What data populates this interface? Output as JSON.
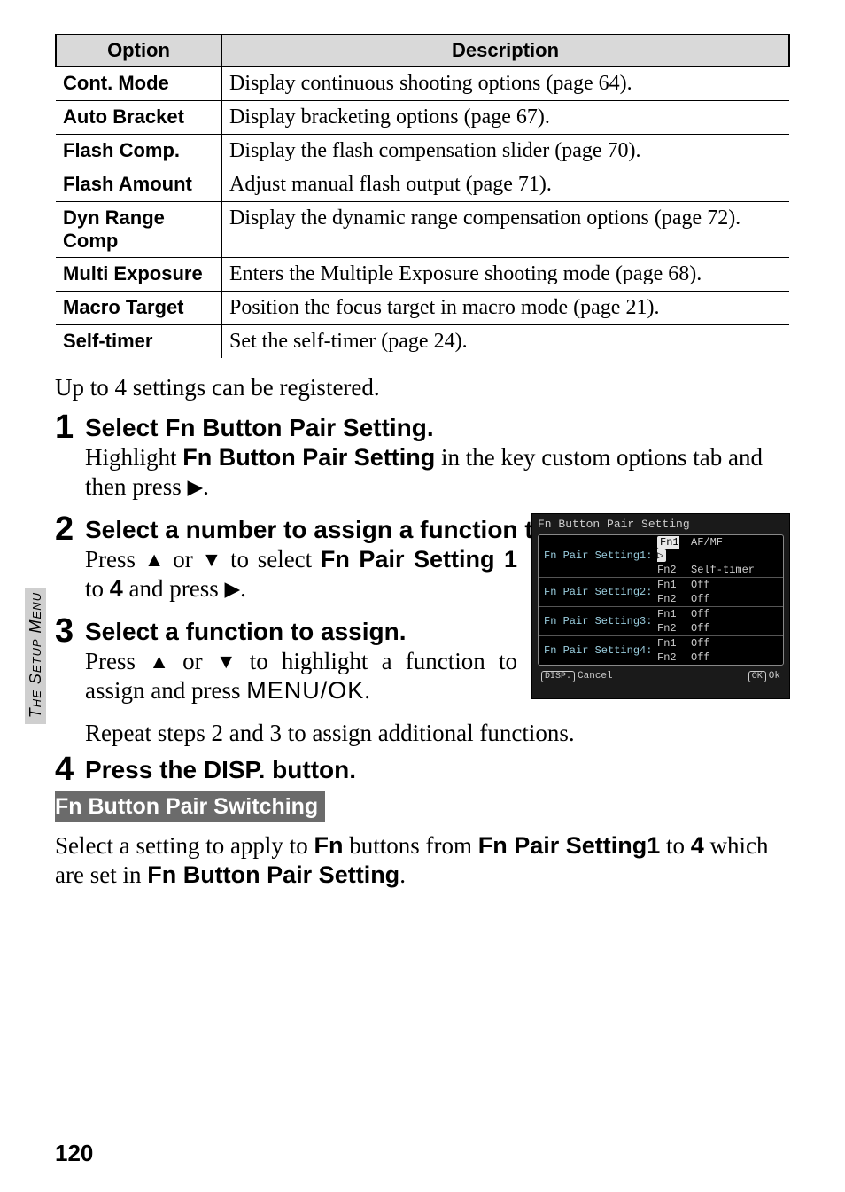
{
  "sidebar_label": "The Setup Menu",
  "table": {
    "headers": {
      "option": "Option",
      "description": "Description"
    },
    "rows": [
      {
        "name": "Cont. Mode",
        "desc": "Display continuous shooting options (page 64)."
      },
      {
        "name": "Auto Bracket",
        "desc": "Display bracketing options (page 67)."
      },
      {
        "name": "Flash Comp.",
        "desc": "Display the flash compensation slider (page 70)."
      },
      {
        "name": "Flash Amount",
        "desc": "Adjust manual flash output (page 71)."
      },
      {
        "name": "Dyn Range Comp",
        "desc": "Display the dynamic range compensation options (page 72)."
      },
      {
        "name": "Multi Exposure",
        "desc": "Enters the Multiple Exposure shooting mode (page 68)."
      },
      {
        "name": "Macro Target",
        "desc": "Position the focus target in macro mode (page 21)."
      },
      {
        "name": "Self-timer",
        "desc": "Set the self-timer (page 24)."
      }
    ]
  },
  "intro": "Up to 4 settings can be registered.",
  "steps": {
    "s1": {
      "num": "1",
      "head_pre": "Select ",
      "head_bold": "Fn Button Pair Setting",
      "head_post": ".",
      "body_pre": "Highlight ",
      "body_bold": "Fn Button Pair Setting",
      "body_mid": " in the key custom options tab and then press ",
      "body_icon": "▶",
      "body_post": "."
    },
    "s2": {
      "num": "2",
      "head": "Select a number to assign a function to.",
      "body_pre": "Press ",
      "body_up": "▲",
      "body_or": " or ",
      "body_dn": "▼",
      "body_mid": " to select ",
      "body_bold1": "Fn Pair Setting 1",
      "body_to": " to ",
      "body_bold2": "4",
      "body_and": " and press ",
      "body_icon": "▶",
      "body_post": "."
    },
    "s3": {
      "num": "3",
      "head": "Select a function to assign.",
      "body_pre": "Press ",
      "body_up": "▲",
      "body_or": " or ",
      "body_dn": "▼",
      "body_mid": " to highlight a function to assign and press ",
      "body_menuok": "MENU/OK",
      "body_post": "."
    },
    "s4": {
      "num": "4",
      "head_pre": "Press the ",
      "head_disp": "DISP.",
      "head_post": " button."
    }
  },
  "repeat": "Repeat steps 2 and 3 to assign additional functions.",
  "screenshot": {
    "title": "Fn Button Pair Setting",
    "rows": [
      {
        "label": "Fn Pair Setting1:",
        "fn1": "Fn1 ▷",
        "v1": "AF/MF",
        "fn2": "Fn2",
        "v2": "Self-timer",
        "hl": true
      },
      {
        "label": "Fn Pair Setting2:",
        "fn1": "Fn1",
        "v1": "Off",
        "fn2": "Fn2",
        "v2": "Off"
      },
      {
        "label": "Fn Pair Setting3:",
        "fn1": "Fn1",
        "v1": "Off",
        "fn2": "Fn2",
        "v2": "Off"
      },
      {
        "label": "Fn Pair Setting4:",
        "fn1": "Fn1",
        "v1": "Off",
        "fn2": "Fn2",
        "v2": "Off"
      }
    ],
    "foot_left_pill": "DISP.",
    "foot_left": "Cancel",
    "foot_right_pill": "OK",
    "foot_right": "Ok"
  },
  "section": {
    "title": "Fn Button Pair Switching",
    "text_pre": "Select a setting to apply to ",
    "text_fn": "Fn",
    "text_mid": " buttons from ",
    "text_b1": "Fn Pair Setting1",
    "text_to": " to ",
    "text_b2": "4",
    "text_which": " which are set in ",
    "text_b3": "Fn Button Pair Setting",
    "text_post": "."
  },
  "page_number": "120"
}
